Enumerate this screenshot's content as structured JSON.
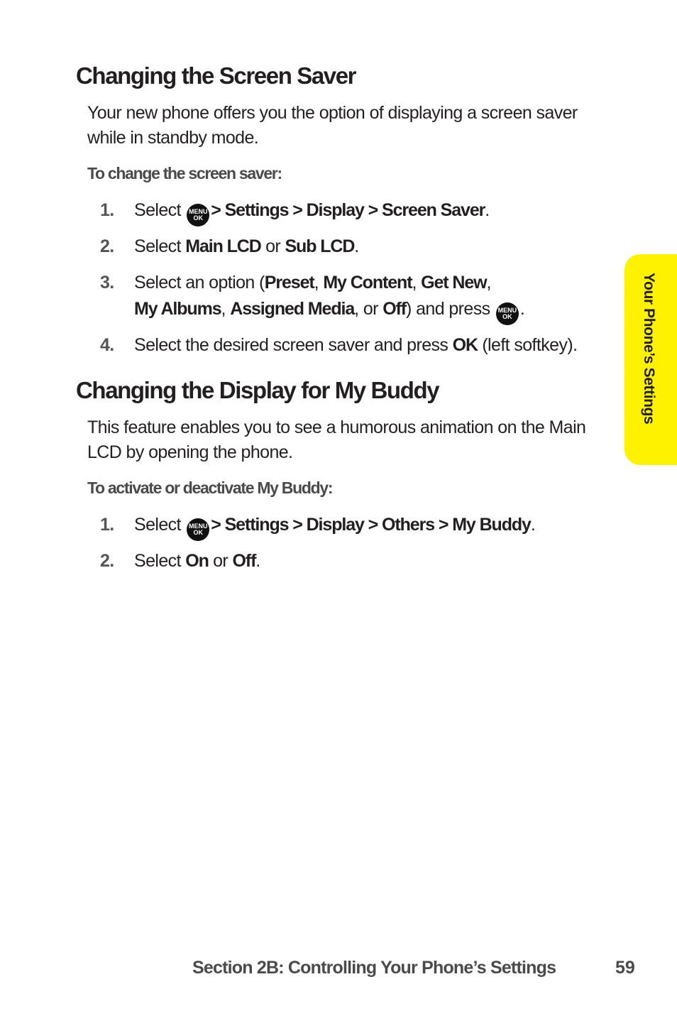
{
  "sections": [
    {
      "heading": "Changing the Screen Saver",
      "intro": "Your new phone offers you the option of displaying a screen saver while in standby mode.",
      "subheading": "To change the screen saver:",
      "steps": [
        {
          "num": "1.",
          "t1": "Select",
          "path": "> Settings > Display > Screen Saver",
          "end": "."
        },
        {
          "num": "2.",
          "t1": "Select ",
          "b1": "Main LCD",
          "t2": " or ",
          "b2": "Sub LCD",
          "end": "."
        },
        {
          "num": "3.",
          "t1": "Select an option (",
          "options": [
            "Preset",
            "My Content",
            "Get New",
            "My Albums",
            "Assigned Media",
            "Off"
          ],
          "sep": ", ",
          "or": ", or ",
          "t2": ") and press",
          "end": "."
        },
        {
          "num": "4.",
          "t1": "Select the desired screen saver and press ",
          "b1": "OK",
          "t2": " (left softkey)."
        }
      ]
    },
    {
      "heading": "Changing the Display for My Buddy",
      "intro": "This feature enables you to see a humorous animation on the Main LCD by opening the phone.",
      "subheading": "To activate or deactivate My Buddy:",
      "steps": [
        {
          "num": "1.",
          "t1": "Select",
          "path": "> Settings > Display > Others > My Buddy",
          "end": "."
        },
        {
          "num": "2.",
          "t1": "Select ",
          "b1": "On",
          "t2": " or ",
          "b2": "Off",
          "end": "."
        }
      ]
    }
  ],
  "menu_key": {
    "icon": "menu-ok-key-icon",
    "line1": "MENU",
    "line2": "OK"
  },
  "side_tab": {
    "label": "Your Phone’s Settings",
    "color": "#fff200"
  },
  "footer": {
    "section": "Section 2B: Controlling Your Phone’s Settings",
    "page_number": "59"
  }
}
